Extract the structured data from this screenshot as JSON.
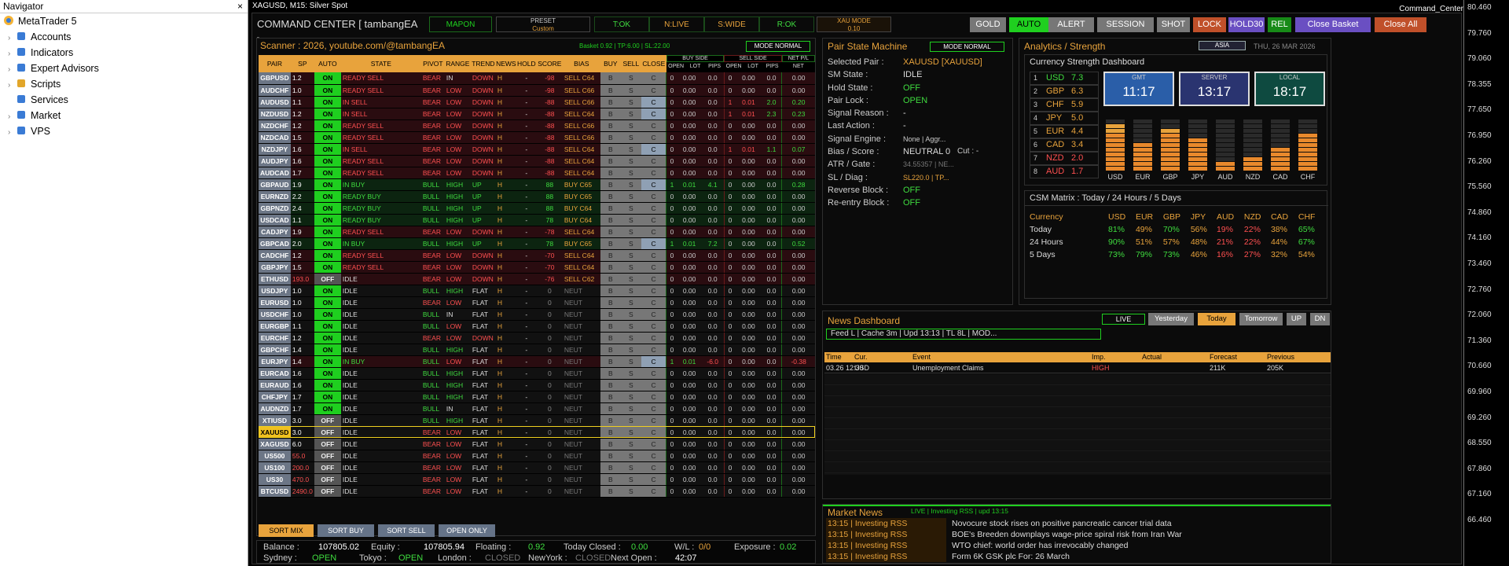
{
  "navigator": {
    "title": "Navigator",
    "close": "×",
    "root": "MetaTrader 5",
    "items": [
      "Accounts",
      "Indicators",
      "Expert Advisors",
      "Scripts",
      "Services",
      "Market",
      "VPS"
    ]
  },
  "chart": {
    "title": "XAGUSD, M15:  Silver Spot",
    "indicator": "Command_Center",
    "axis": [
      "80.460",
      "79.760",
      "79.060",
      "78.355",
      "77.650",
      "76.950",
      "76.260",
      "75.560",
      "74.860",
      "74.160",
      "73.460",
      "72.760",
      "72.060",
      "71.360",
      "70.660",
      "69.960",
      "69.260",
      "68.550",
      "67.860",
      "67.160",
      "66.460"
    ]
  },
  "header": {
    "title": "COMMAND CENTER [ tambangEA ]",
    "mapon": "MAPON",
    "preset_l": "PRESET",
    "preset_v": "Custom",
    "tok": "T:OK",
    "nlive": "N:LIVE",
    "swide": "S:WIDE",
    "rok": "R:OK",
    "xau_l": "XAU MODE",
    "xau_v": "0.10",
    "buttons": [
      "GOLD",
      "AUTO",
      "ALERT",
      "SESSION",
      "SHOT",
      "LOCK",
      "HOLD30",
      "REL",
      "Close Basket",
      "Close All"
    ]
  },
  "scanner": {
    "title": "Scanner : 2026, youtube.com/@tambangEA",
    "basket": "Basket 0.92 | TP:6.00 | SL:22.00",
    "mode": "MODE NORMAL",
    "cols": [
      "PAIR",
      "SP",
      "AUTO",
      "STATE",
      "PIVOT",
      "RANGE",
      "TREND",
      "NEWS",
      "HOLD",
      "SCORE",
      "BIAS",
      "BUY",
      "SELL",
      "CLOSE"
    ],
    "buyside": "BUY SIDE",
    "sellside": "SELL SIDE",
    "netpl": "NET P/L",
    "sub": [
      "OPEN",
      "LOT",
      "PIPS",
      "OPEN",
      "LOT",
      "PIPS",
      "NET"
    ],
    "rows": [
      [
        "GBPUSD",
        "1.2",
        "ON",
        "READY SELL",
        "BEAR",
        "IN",
        "DOWN",
        "H",
        "-",
        "-98",
        "SELL C64",
        "0",
        "0.00",
        "0.0",
        "0",
        "0.00",
        "0.0",
        "0.00"
      ],
      [
        "AUDCHF",
        "1.0",
        "ON",
        "READY SELL",
        "BEAR",
        "LOW",
        "DOWN",
        "H",
        "-",
        "-98",
        "SELL C66",
        "0",
        "0.00",
        "0.0",
        "0",
        "0.00",
        "0.0",
        "0.00"
      ],
      [
        "AUDUSD",
        "1.1",
        "ON",
        "IN SELL",
        "BEAR",
        "LOW",
        "DOWN",
        "H",
        "-",
        "-88",
        "SELL C66",
        "0",
        "0.00",
        "0.0",
        "1",
        "0.01",
        "2.0",
        "0.20"
      ],
      [
        "NZDUSD",
        "1.2",
        "ON",
        "IN SELL",
        "BEAR",
        "LOW",
        "DOWN",
        "H",
        "-",
        "-88",
        "SELL C64",
        "0",
        "0.00",
        "0.0",
        "1",
        "0.01",
        "2.3",
        "0.23"
      ],
      [
        "NZDCHF",
        "1.2",
        "ON",
        "READY SELL",
        "BEAR",
        "LOW",
        "DOWN",
        "H",
        "-",
        "-88",
        "SELL C66",
        "0",
        "0.00",
        "0.0",
        "0",
        "0.00",
        "0.0",
        "0.00"
      ],
      [
        "NZDCAD",
        "1.5",
        "ON",
        "READY SELL",
        "BEAR",
        "LOW",
        "DOWN",
        "H",
        "-",
        "-88",
        "SELL C66",
        "0",
        "0.00",
        "0.0",
        "0",
        "0.00",
        "0.0",
        "0.00"
      ],
      [
        "NZDJPY",
        "1.6",
        "ON",
        "IN SELL",
        "BEAR",
        "LOW",
        "DOWN",
        "H",
        "-",
        "-88",
        "SELL C64",
        "0",
        "0.00",
        "0.0",
        "1",
        "0.01",
        "1.1",
        "0.07"
      ],
      [
        "AUDJPY",
        "1.6",
        "ON",
        "READY SELL",
        "BEAR",
        "LOW",
        "DOWN",
        "H",
        "-",
        "-88",
        "SELL C64",
        "0",
        "0.00",
        "0.0",
        "0",
        "0.00",
        "0.0",
        "0.00"
      ],
      [
        "AUDCAD",
        "1.7",
        "ON",
        "READY SELL",
        "BEAR",
        "LOW",
        "DOWN",
        "H",
        "-",
        "-88",
        "SELL C64",
        "0",
        "0.00",
        "0.0",
        "0",
        "0.00",
        "0.0",
        "0.00"
      ],
      [
        "GBPAUD",
        "1.9",
        "ON",
        "IN BUY",
        "BULL",
        "HIGH",
        "UP",
        "H",
        "-",
        "88",
        "BUY C65",
        "1",
        "0.01",
        "4.1",
        "0",
        "0.00",
        "0.0",
        "0.28"
      ],
      [
        "EURNZD",
        "2.2",
        "ON",
        "READY BUY",
        "BULL",
        "HIGH",
        "UP",
        "H",
        "-",
        "88",
        "BUY C65",
        "0",
        "0.00",
        "0.0",
        "0",
        "0.00",
        "0.0",
        "0.00"
      ],
      [
        "GBPNZD",
        "2.4",
        "ON",
        "READY BUY",
        "BULL",
        "HIGH",
        "UP",
        "H",
        "-",
        "88",
        "BUY C64",
        "0",
        "0.00",
        "0.0",
        "0",
        "0.00",
        "0.0",
        "0.00"
      ],
      [
        "USDCAD",
        "1.1",
        "ON",
        "READY BUY",
        "BULL",
        "HIGH",
        "UP",
        "H",
        "-",
        "78",
        "BUY C64",
        "0",
        "0.00",
        "0.0",
        "0",
        "0.00",
        "0.0",
        "0.00"
      ],
      [
        "CADJPY",
        "1.9",
        "ON",
        "READY SELL",
        "BEAR",
        "LOW",
        "DOWN",
        "H",
        "-",
        "-78",
        "SELL C64",
        "0",
        "0.00",
        "0.0",
        "0",
        "0.00",
        "0.0",
        "0.00"
      ],
      [
        "GBPCAD",
        "2.0",
        "ON",
        "IN BUY",
        "BULL",
        "HIGH",
        "UP",
        "H",
        "-",
        "78",
        "BUY C65",
        "1",
        "0.01",
        "7.2",
        "0",
        "0.00",
        "0.0",
        "0.52"
      ],
      [
        "CADCHF",
        "1.2",
        "ON",
        "READY SELL",
        "BEAR",
        "LOW",
        "DOWN",
        "H",
        "-",
        "-70",
        "SELL C64",
        "0",
        "0.00",
        "0.0",
        "0",
        "0.00",
        "0.0",
        "0.00"
      ],
      [
        "GBPJPY",
        "1.5",
        "ON",
        "READY SELL",
        "BEAR",
        "LOW",
        "DOWN",
        "H",
        "-",
        "-70",
        "SELL C64",
        "0",
        "0.00",
        "0.0",
        "0",
        "0.00",
        "0.0",
        "0.00"
      ],
      [
        "ETHUSD",
        "193.0",
        "OFF",
        "IDLE",
        "BEAR",
        "LOW",
        "DOWN",
        "H",
        "-",
        "-76",
        "SELL C62",
        "0",
        "0.00",
        "0.0",
        "0",
        "0.00",
        "0.0",
        "0.00"
      ],
      [
        "USDJPY",
        "1.0",
        "ON",
        "IDLE",
        "BULL",
        "HIGH",
        "FLAT",
        "H",
        "-",
        "0",
        "NEUT",
        "0",
        "0.00",
        "0.0",
        "0",
        "0.00",
        "0.0",
        "0.00"
      ],
      [
        "EURUSD",
        "1.0",
        "ON",
        "IDLE",
        "BEAR",
        "LOW",
        "FLAT",
        "H",
        "-",
        "0",
        "NEUT",
        "0",
        "0.00",
        "0.0",
        "0",
        "0.00",
        "0.0",
        "0.00"
      ],
      [
        "USDCHF",
        "1.0",
        "ON",
        "IDLE",
        "BULL",
        "IN",
        "FLAT",
        "H",
        "-",
        "0",
        "NEUT",
        "0",
        "0.00",
        "0.0",
        "0",
        "0.00",
        "0.0",
        "0.00"
      ],
      [
        "EURGBP",
        "1.1",
        "ON",
        "IDLE",
        "BULL",
        "LOW",
        "FLAT",
        "H",
        "-",
        "0",
        "NEUT",
        "0",
        "0.00",
        "0.0",
        "0",
        "0.00",
        "0.0",
        "0.00"
      ],
      [
        "EURCHF",
        "1.2",
        "ON",
        "IDLE",
        "BEAR",
        "LOW",
        "DOWN",
        "H",
        "-",
        "0",
        "NEUT",
        "0",
        "0.00",
        "0.0",
        "0",
        "0.00",
        "0.0",
        "0.00"
      ],
      [
        "GBPCHF",
        "1.4",
        "ON",
        "IDLE",
        "BULL",
        "HIGH",
        "FLAT",
        "H",
        "-",
        "0",
        "NEUT",
        "0",
        "0.00",
        "0.0",
        "0",
        "0.00",
        "0.0",
        "0.00"
      ],
      [
        "EURJPY",
        "1.4",
        "ON",
        "IN BUY",
        "BULL",
        "LOW",
        "FLAT",
        "H",
        "-",
        "0",
        "NEUT",
        "1",
        "0.01",
        "-6.0",
        "0",
        "0.00",
        "0.0",
        "-0.38"
      ],
      [
        "EURCAD",
        "1.6",
        "ON",
        "IDLE",
        "BULL",
        "HIGH",
        "FLAT",
        "H",
        "-",
        "0",
        "NEUT",
        "0",
        "0.00",
        "0.0",
        "0",
        "0.00",
        "0.0",
        "0.00"
      ],
      [
        "EURAUD",
        "1.6",
        "ON",
        "IDLE",
        "BULL",
        "HIGH",
        "FLAT",
        "H",
        "-",
        "0",
        "NEUT",
        "0",
        "0.00",
        "0.0",
        "0",
        "0.00",
        "0.0",
        "0.00"
      ],
      [
        "CHFJPY",
        "1.7",
        "ON",
        "IDLE",
        "BULL",
        "HIGH",
        "FLAT",
        "H",
        "-",
        "0",
        "NEUT",
        "0",
        "0.00",
        "0.0",
        "0",
        "0.00",
        "0.0",
        "0.00"
      ],
      [
        "AUDNZD",
        "1.7",
        "ON",
        "IDLE",
        "BULL",
        "IN",
        "FLAT",
        "H",
        "-",
        "0",
        "NEUT",
        "0",
        "0.00",
        "0.0",
        "0",
        "0.00",
        "0.0",
        "0.00"
      ],
      [
        "XTIUSD",
        "3.0",
        "OFF",
        "IDLE",
        "BULL",
        "HIGH",
        "FLAT",
        "H",
        "-",
        "0",
        "NEUT",
        "0",
        "0.00",
        "0.0",
        "0",
        "0.00",
        "0.0",
        "0.00"
      ],
      [
        "XAUUSD",
        "3.0",
        "OFF",
        "IDLE",
        "BEAR",
        "LOW",
        "FLAT",
        "H",
        "-",
        "0",
        "NEUT",
        "0",
        "0.00",
        "0.0",
        "0",
        "0.00",
        "0.0",
        "0.00"
      ],
      [
        "XAGUSD",
        "6.0",
        "OFF",
        "IDLE",
        "BEAR",
        "LOW",
        "FLAT",
        "H",
        "-",
        "0",
        "NEUT",
        "0",
        "0.00",
        "0.0",
        "0",
        "0.00",
        "0.0",
        "0.00"
      ],
      [
        "US500",
        "55.0",
        "OFF",
        "IDLE",
        "BEAR",
        "LOW",
        "FLAT",
        "H",
        "-",
        "0",
        "NEUT",
        "0",
        "0.00",
        "0.0",
        "0",
        "0.00",
        "0.0",
        "0.00"
      ],
      [
        "US100",
        "200.0",
        "OFF",
        "IDLE",
        "BEAR",
        "LOW",
        "FLAT",
        "H",
        "-",
        "0",
        "NEUT",
        "0",
        "0.00",
        "0.0",
        "0",
        "0.00",
        "0.0",
        "0.00"
      ],
      [
        "US30",
        "470.0",
        "OFF",
        "IDLE",
        "BEAR",
        "LOW",
        "FLAT",
        "H",
        "-",
        "0",
        "NEUT",
        "0",
        "0.00",
        "0.0",
        "0",
        "0.00",
        "0.0",
        "0.00"
      ],
      [
        "BTCUSD",
        "2490.0",
        "OFF",
        "IDLE",
        "BEAR",
        "LOW",
        "FLAT",
        "H",
        "-",
        "0",
        "NEUT",
        "0",
        "0.00",
        "0.0",
        "0",
        "0.00",
        "0.0",
        "0.00"
      ]
    ],
    "buy": "B",
    "sell": "S",
    "close": "C",
    "sort": [
      "SORT MIX",
      "SORT BUY",
      "SORT SELL",
      "OPEN ONLY"
    ]
  },
  "pair_state": {
    "title": "Pair State Machine",
    "mode": "MODE NORMAL",
    "rows": [
      [
        "Selected Pair :",
        "XAUUSD [XAUUSD]"
      ],
      [
        "SM State :",
        "IDLE"
      ],
      [
        "Hold State :",
        "OFF"
      ],
      [
        "Pair Lock :",
        "OPEN"
      ],
      [
        "Signal Reason :",
        "-"
      ],
      [
        "Last Action :",
        "-"
      ],
      [
        "Signal Engine :",
        "None | Aggr..."
      ],
      [
        "Bias / Score :",
        "NEUTRAL 0"
      ],
      [
        "ATR / Gate :",
        "34.55357 | NE..."
      ],
      [
        "SL / Diag :",
        "SL220.0 | TP..."
      ],
      [
        "Reverse Block :",
        "OFF"
      ],
      [
        "Re-entry Block :",
        "OFF"
      ]
    ],
    "cut": "Cut : -"
  },
  "analytics": {
    "title": "Analytics / Strength",
    "session": "ASIA",
    "date": "THU, 26 MAR 2026",
    "csd": "Currency Strength Dashboard",
    "ranks": [
      [
        "1",
        "USD",
        "7.3"
      ],
      [
        "2",
        "GBP",
        "6.3"
      ],
      [
        "3",
        "CHF",
        "5.9"
      ],
      [
        "4",
        "JPY",
        "5.0"
      ],
      [
        "5",
        "EUR",
        "4.4"
      ],
      [
        "6",
        "CAD",
        "3.4"
      ],
      [
        "7",
        "NZD",
        "2.0"
      ],
      [
        "8",
        "AUD",
        "1.7"
      ]
    ],
    "clocks": [
      [
        "GMT",
        "11:17"
      ],
      [
        "SERVER",
        "13:17"
      ],
      [
        "LOCAL",
        "18:17"
      ]
    ],
    "bars": {
      "labels": [
        "USD",
        "EUR",
        "GBP",
        "JPY",
        "AUD",
        "NZD",
        "CAD",
        "CHF"
      ],
      "values": [
        7.3,
        4.4,
        6.3,
        5.0,
        1.7,
        2.0,
        3.4,
        5.9
      ]
    },
    "matrix_title": "CSM Matrix : Today / 24 Hours / 5 Days",
    "matrix_cols": [
      "Currency",
      "USD",
      "EUR",
      "GBP",
      "JPY",
      "AUD",
      "NZD",
      "CAD",
      "CHF"
    ],
    "matrix": [
      [
        "Today",
        "81%",
        "49%",
        "70%",
        "56%",
        "19%",
        "22%",
        "38%",
        "65%"
      ],
      [
        "24 Hours",
        "90%",
        "51%",
        "57%",
        "48%",
        "21%",
        "22%",
        "44%",
        "67%"
      ],
      [
        "5 Days",
        "73%",
        "79%",
        "73%",
        "46%",
        "16%",
        "27%",
        "32%",
        "54%"
      ]
    ]
  },
  "news": {
    "title": "News Dashboard",
    "live": "LIVE",
    "tabs": [
      "Yesterday",
      "Today",
      "Tomorrow",
      "UP",
      "DN"
    ],
    "feed": "Feed L | Cache 3m | Upd 13:13 | TL 8L | MOD...",
    "cols": [
      "Time",
      "Cur.",
      "Event",
      "Imp.",
      "Actual",
      "Forecast",
      "Previous"
    ],
    "row": [
      "03.26 12:30",
      "USD",
      "Unemployment Claims",
      "HIGH",
      "",
      "211K",
      "205K"
    ]
  },
  "market_news": {
    "title": "Market News",
    "status": "LIVE | Investing RSS | upd 13:15",
    "items": [
      [
        "13:15 | Investing RSS",
        "Novocure stock rises on positive pancreatic cancer trial data"
      ],
      [
        "13:15 | Investing RSS",
        "BOE's Breeden downplays wage-price spiral risk from Iran War"
      ],
      [
        "13:15 | Investing RSS",
        "WTO chief: world order has irrevocably changed"
      ],
      [
        "13:15 | Investing RSS",
        "Form 6K GSK plc For: 26 March"
      ]
    ]
  },
  "footer": {
    "balance_l": "Balance :",
    "balance": "107805.02",
    "equity_l": "Equity :",
    "equity": "107805.94",
    "floating_l": "Floating :",
    "floating": "0.92",
    "tclosed_l": "Today Closed :",
    "tclosed": "0.00",
    "wl_l": "W/L :",
    "wl": "0/0",
    "exp_l": "Exposure :",
    "exp": "0.02",
    "sydney_l": "Sydney :",
    "sydney": "OPEN",
    "tokyo_l": "Tokyo :",
    "tokyo": "OPEN",
    "london_l": "London :",
    "london": "CLOSED",
    "ny_l": "NewYork :",
    "ny": "CLOSED",
    "next_l": "Next Open :",
    "next": "42:07"
  }
}
